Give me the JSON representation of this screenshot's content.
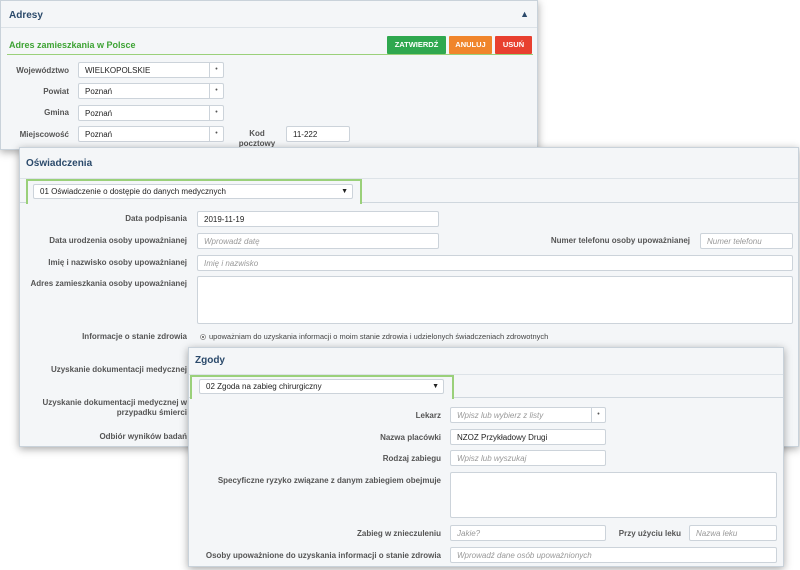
{
  "adresy": {
    "title": "Adresy",
    "section_title": "Adres zamieszkania w Polsce",
    "buttons": {
      "confirm": "ZATWIERDŹ",
      "cancel": "ANULUJ",
      "delete": "USUŃ"
    },
    "colors": {
      "confirm": "#2fa84f",
      "cancel": "#f0852b",
      "delete": "#e8402f"
    },
    "fields": {
      "wojewodztwo_label": "Województwo",
      "wojewodztwo_value": "WIELKOPOLSKIE",
      "powiat_label": "Powiat",
      "powiat_value": "Poznań",
      "gmina_label": "Gmina",
      "gmina_value": "Poznań",
      "miejscowosc_label": "Miejscowość",
      "miejscowosc_value": "Poznań",
      "kod_label_1": "Kod",
      "kod_label_2": "pocztowy",
      "kod_value": "11-222"
    }
  },
  "oswiadczenia": {
    "title": "Oświadczenia",
    "selected": "01 Oświadczenie o dostępie do danych medycznych",
    "data_podpisania_label": "Data podpisania",
    "data_podpisania_value": "2019-11-19",
    "data_urodzenia_label": "Data urodzenia osoby upoważnianej",
    "data_urodzenia_placeholder": "Wprowadź datę",
    "telefon_label": "Numer telefonu osoby upoważnianej",
    "telefon_placeholder": "Numer telefonu",
    "imie_label": "Imię i nazwisko osoby upoważnianej",
    "imie_placeholder": "Imię i nazwisko",
    "adres_label": "Adres zamieszkania osoby upoważnianej",
    "informacje_label": "Informacje o stanie zdrowia",
    "informacje_option": "upoważniam do uzyskania informacji o moim stanie zdrowia i udzielonych świadczeniach zdrowotnych",
    "uzyskanie_label": "Uzyskanie dokumentacji medycznej",
    "uzyskanie_smierc_label_1": "Uzyskanie dokumentacji medycznej w",
    "uzyskanie_smierc_label_2": "przypadku śmierci",
    "odbior_label": "Odbiór wyników badań"
  },
  "zgody": {
    "title": "Zgody",
    "selected": "02 Zgoda na zabieg chirurgiczny",
    "lekarz_label": "Lekarz",
    "lekarz_placeholder": "Wpisz lub wybierz z listy",
    "placowka_label": "Nazwa placówki",
    "placowka_value": "NZOZ Przykładowy Drugi",
    "rodzaj_label": "Rodzaj zabiegu",
    "rodzaj_placeholder": "Wpisz lub wyszukaj",
    "ryzyko_label": "Specyficzne ryzyko związane z danym zabiegiem obejmuje",
    "znieczulenie_label": "Zabieg w znieczuleniu",
    "znieczulenie_placeholder": "Jakie?",
    "lek_label": "Przy użyciu leku",
    "lek_placeholder": "Nazwa leku",
    "osoby_label": "Osoby upoważnione do uzyskania informacji o stanie zdrowia",
    "osoby_placeholder": "Wprowadź dane osób upoważnionych"
  }
}
